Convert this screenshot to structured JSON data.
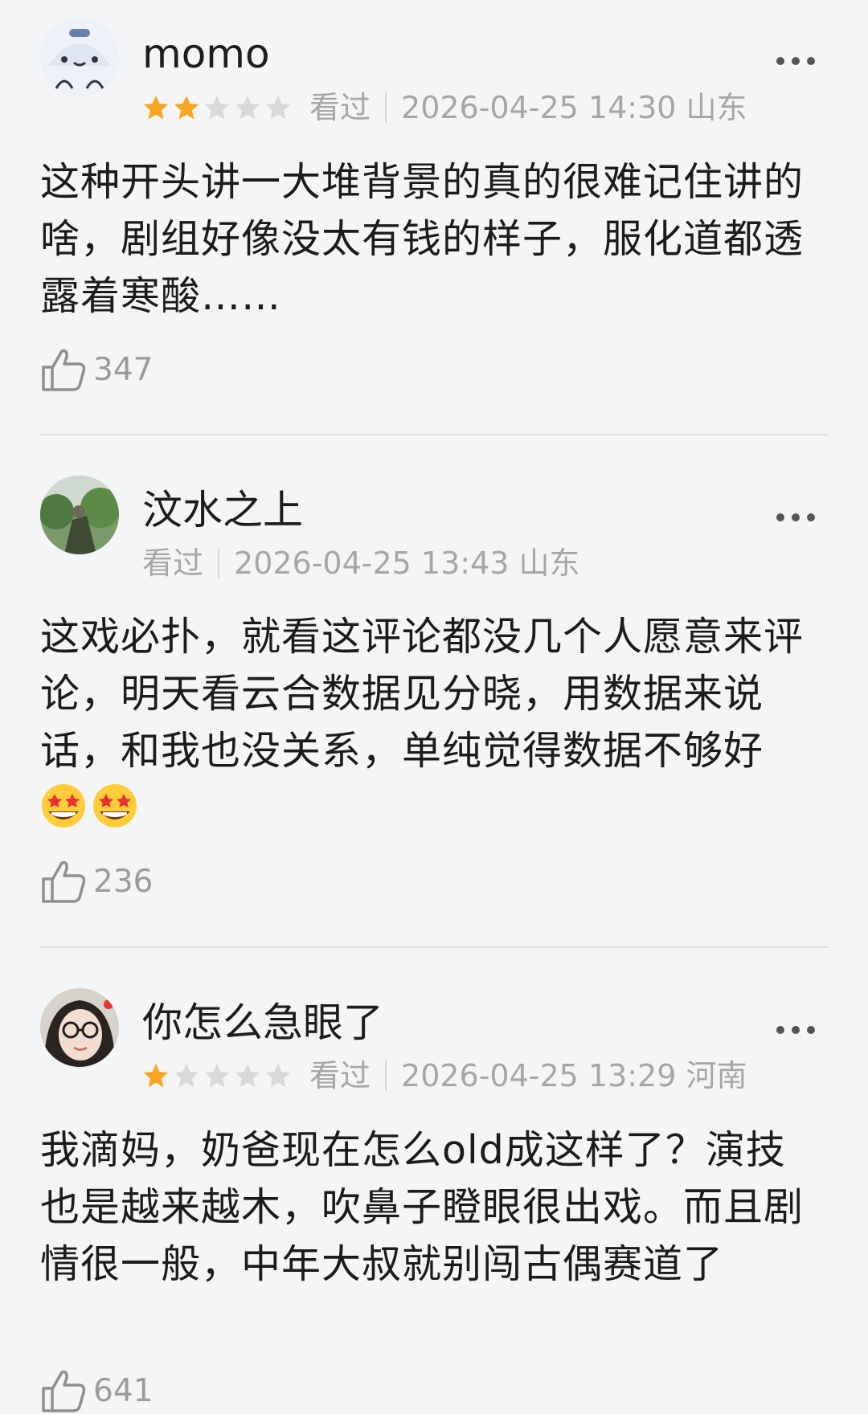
{
  "reviews": [
    {
      "name": "momo",
      "rating": 2,
      "rating_max": 5,
      "watch_status": "看过",
      "datetime": "2026-04-25 14:30",
      "location": "山东",
      "text": "这种开头讲一大堆背景的真的很难记住讲的啥，剧组好像没太有钱的样子，服化道都透露着寒酸……",
      "likes": "347",
      "avatar_icon": "cartoon-face-avatar"
    },
    {
      "name": "汶水之上",
      "watch_status": "看过",
      "datetime": "2026-04-25 13:43",
      "location": "山东",
      "text": "这戏必扑，就看这评论都没几个人愿意来评论，明天看云合数据见分晓，用数据来说话，和我也没关系，单纯觉得数据不够好",
      "text_emoji": "star-struck-emoji",
      "likes": "236",
      "avatar_icon": "photo-avatar"
    },
    {
      "name": "你怎么急眼了",
      "rating": 1,
      "rating_max": 5,
      "watch_status": "看过",
      "datetime": "2026-04-25 13:29",
      "location": "河南",
      "text": "我滴妈，奶爸现在怎么old成这样了？演技也是越来越木，吹鼻子瞪眼很出戏。而且剧情很一般，中年大叔就别闯古偶赛道了",
      "likes": "641",
      "avatar_icon": "girl-photo-avatar"
    }
  ],
  "colors": {
    "star_filled": "#f5a623",
    "star_empty": "#d9d9d9",
    "meta_text": "#a6a6a6",
    "background": "#f4f5f7"
  }
}
